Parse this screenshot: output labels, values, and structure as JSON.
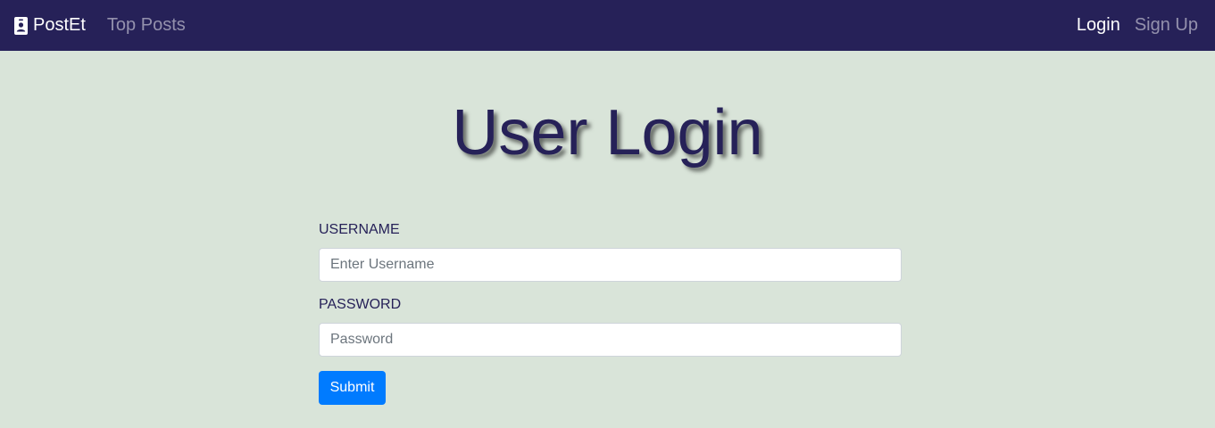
{
  "navbar": {
    "brand_label": "PostEt",
    "brand_icon": "person-badge-icon",
    "top_posts_label": "Top Posts",
    "login_label": "Login",
    "signup_label": "Sign Up"
  },
  "main": {
    "title": "User Login",
    "form": {
      "username_label": "USERNAME",
      "username_placeholder": "Enter Username",
      "username_value": "",
      "password_label": "PASSWORD",
      "password_placeholder": "Password",
      "password_value": "",
      "submit_label": "Submit"
    }
  },
  "colors": {
    "navbar_bg": "#262158",
    "page_bg": "#d9e4d9",
    "title_color": "#262158",
    "submit_bg": "#007bff"
  }
}
